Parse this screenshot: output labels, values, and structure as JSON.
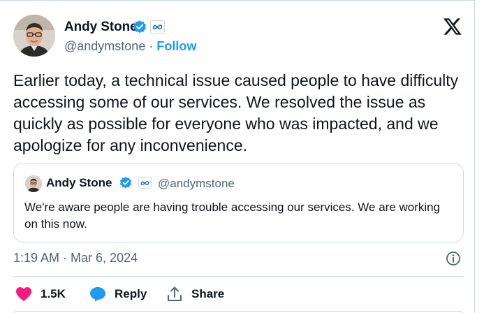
{
  "author": {
    "name": "Andy Stone",
    "handle": "@andymstone",
    "separator": " · ",
    "follow_label": "Follow"
  },
  "tweet": {
    "text": "Earlier today, a technical issue caused people to have difficulty accessing some of our services. We resolved the issue as quickly as possible for everyone who was impacted, and we apologize for any inconvenience."
  },
  "quoted_tweet": {
    "name": "Andy Stone",
    "handle": "@andymstone",
    "text": "We're aware people are having trouble accessing our services. We are working on this now."
  },
  "timestamp": "1:19 AM · Mar 6, 2024",
  "actions": {
    "likes": "1.5K",
    "reply_label": "Reply",
    "share_label": "Share"
  },
  "icons": {
    "verified": "verified-badge-icon",
    "affiliate": "meta-affiliate-icon",
    "platform": "x-logo-icon",
    "info": "info-icon",
    "like": "heart-icon",
    "reply": "reply-bubble-icon",
    "share": "share-upload-icon"
  },
  "colors": {
    "accent": "#1d9bf0",
    "like": "#f91880",
    "text": "#0f1419",
    "muted": "#536471",
    "border": "#cfd9de"
  }
}
